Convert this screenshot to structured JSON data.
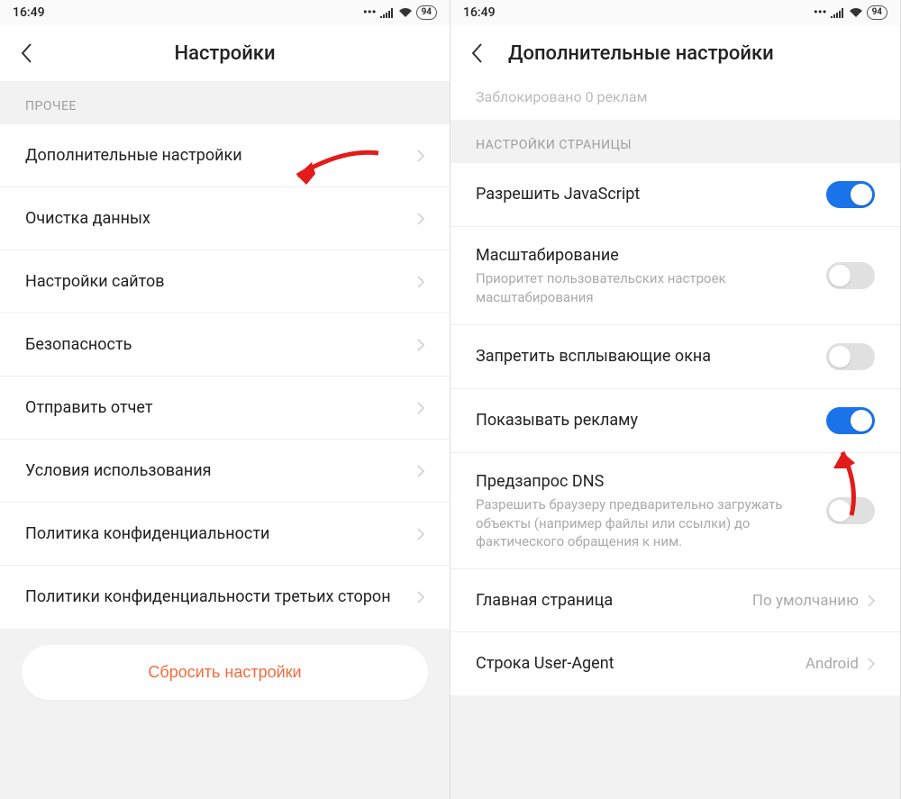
{
  "status": {
    "time": "16:49",
    "battery": "94"
  },
  "left": {
    "title": "Настройки",
    "section": "ПРОЧЕЕ",
    "items": [
      {
        "label": "Дополнительные настройки"
      },
      {
        "label": "Очистка данных"
      },
      {
        "label": "Настройки сайтов"
      },
      {
        "label": "Безопасность"
      },
      {
        "label": "Отправить отчет"
      },
      {
        "label": "Условия использования"
      },
      {
        "label": "Политика конфиденциальности"
      },
      {
        "label": "Политики конфиденциальности третьих сторон"
      }
    ],
    "reset": "Сбросить настройки"
  },
  "right": {
    "title": "Дополнительные настройки",
    "faded_line": "Заблокировано 0 реклам",
    "section": "НАСТРОЙКИ СТРАНИЦЫ",
    "items": [
      {
        "label": "Разрешить JavaScript",
        "toggle": true
      },
      {
        "label": "Масштабирование",
        "sub": "Приоритет пользовательских настроек масштабирования",
        "toggle": false
      },
      {
        "label": "Запретить всплывающие окна",
        "toggle": false
      },
      {
        "label": "Показывать рекламу",
        "toggle": true
      },
      {
        "label": "Предзапрос DNS",
        "sub": "Разрешить браузеру предварительно загружать объекты (например файлы или ссылки) до фактического обращения к ним.",
        "toggle": false
      },
      {
        "label": "Главная страница",
        "value": "По умолчанию"
      },
      {
        "label": "Строка User-Agent",
        "value": "Android"
      }
    ]
  }
}
